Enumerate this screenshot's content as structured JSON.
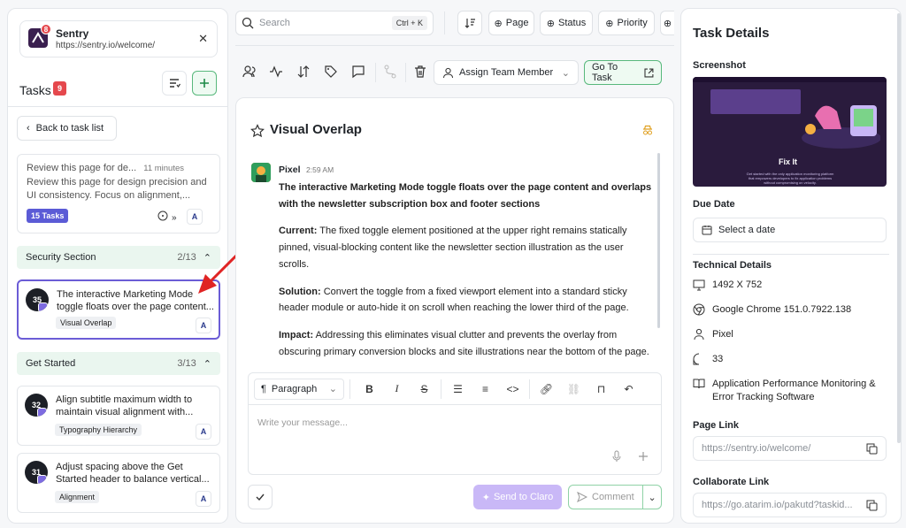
{
  "colors": {
    "accent_green": "#58b87c",
    "accent_purple": "#6b5cd6",
    "badge_red": "#e5484d",
    "pill_blue": "#5b5bd6"
  },
  "site": {
    "badge": "8",
    "name": "Sentry",
    "url": "https://sentry.io/welcome/"
  },
  "tasks": {
    "title": "Tasks",
    "count": "9"
  },
  "back_label": "Back to task list",
  "review": {
    "title": "Review this page for de...",
    "time": "11 minutes",
    "body": "Review this page for design precision and UI consistency. Focus on alignment,...",
    "pill": "15 Tasks"
  },
  "sections": [
    {
      "name": "Security Section",
      "count": "2/13"
    },
    {
      "name": "Get Started",
      "count": "3/13"
    }
  ],
  "task_items": [
    {
      "num": "35",
      "text": "The interactive Marketing Mode toggle floats over the page content...",
      "tag": "Visual Overlap"
    },
    {
      "num": "32",
      "text": "Align subtitle maximum width to maintain visual alignment with...",
      "tag": "Typography Hierarchy"
    },
    {
      "num": "31",
      "text": "Adjust spacing above the Get Started header to balance vertical...",
      "tag": "Alignment"
    }
  ],
  "topbar": {
    "search_placeholder": "Search",
    "shortcut": "Ctrl + K",
    "page_label": "Page",
    "status_label": "Status",
    "priority_label": "Priority"
  },
  "toolbar": {
    "assign_label": "Assign Team Member",
    "goto_label": "Go To Task"
  },
  "task": {
    "title": "Visual Overlap",
    "author": "Pixel",
    "time": "2:59 AM",
    "headline": "The interactive Marketing Mode toggle floats over the page content and overlaps with the newsletter subscription box and footer sections",
    "current_label": "Current:",
    "current": " The fixed toggle element positioned at the upper right remains statically pinned, visual-blocking content like the newsletter section illustration as the user scrolls.",
    "solution_label": "Solution:",
    "solution": " Convert the toggle from a fixed viewport element into a standard sticky header module or auto-hide it on scroll when reaching the lower third of the page.",
    "impact_label": "Impact:",
    "impact": " Addressing this eliminates visual clutter and prevents the overlay from obscuring primary conversion blocks and site illustrations near the bottom of the page."
  },
  "editor": {
    "paragraph_label": "Paragraph",
    "placeholder": "Write your message..."
  },
  "actions": {
    "send_label": "Send to Claro",
    "comment_label": "Comment"
  },
  "details": {
    "title": "Task Details",
    "screenshot_label": "Screenshot",
    "screenshot_caption": "Fix It",
    "screenshot_subtext": "Get started with the only application monitoring platform that empowers developers to fix application problems without compromising on velocity.",
    "due_label": "Due Date",
    "due_placeholder": "Select a date",
    "tech_label": "Technical Details",
    "resolution": "1492 X 752",
    "browser": "Google Chrome 151.0.7922.138",
    "user": "Pixel",
    "task_id": "33",
    "category": "Application Performance Monitoring & Error Tracking Software",
    "page_link_label": "Page Link",
    "page_link": "https://sentry.io/welcome/",
    "collab_label": "Collaborate Link",
    "collab_link": "https://go.atarim.io/pakutd?taskid..."
  }
}
